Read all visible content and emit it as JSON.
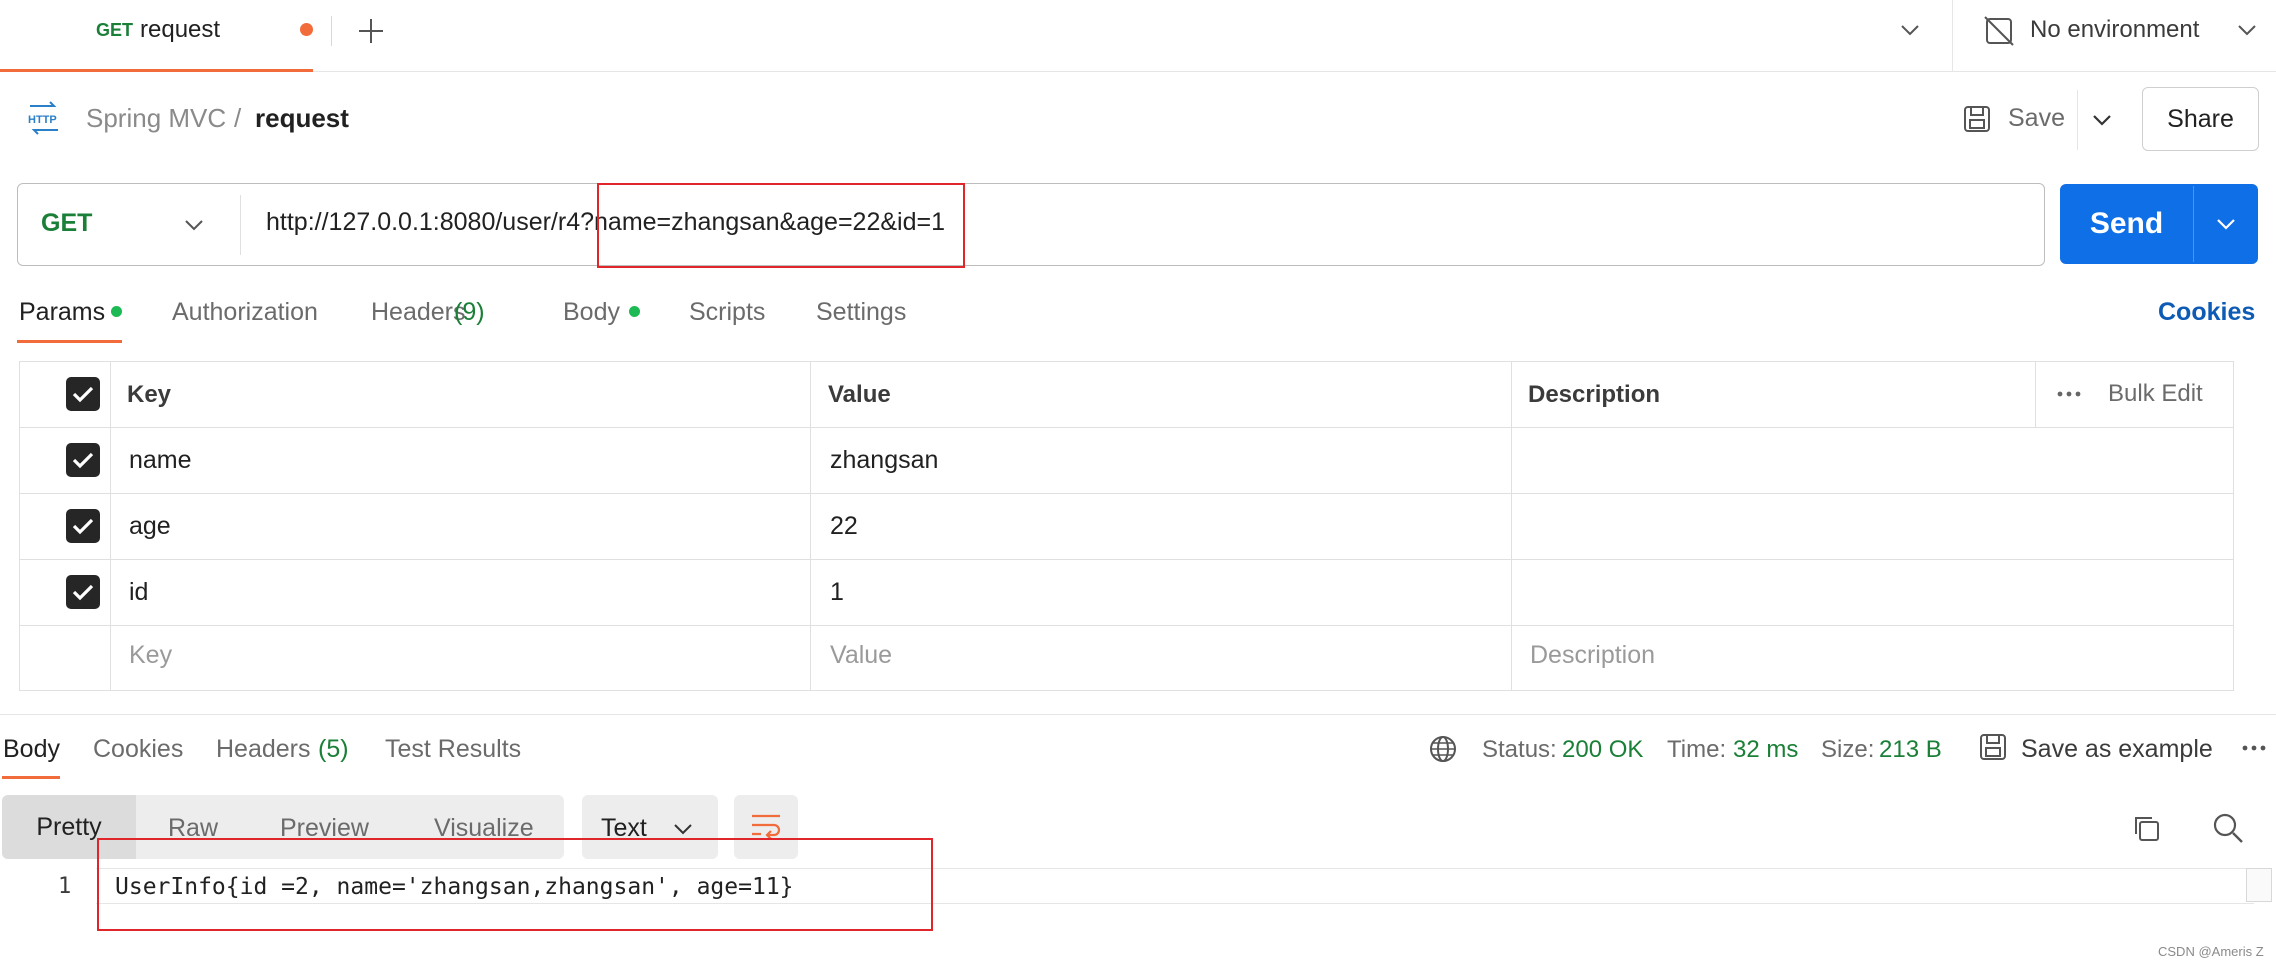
{
  "tab": {
    "method": "GET",
    "name": "request"
  },
  "environment": {
    "label": "No environment"
  },
  "breadcrumb": {
    "parent": "Spring MVC",
    "separator": "/",
    "current": "request"
  },
  "actions": {
    "save": "Save",
    "share": "Share"
  },
  "request": {
    "method": "GET",
    "url": "http://127.0.0.1:8080/user/r4?name=zhangsan&age=22&id=1",
    "send": "Send"
  },
  "request_tabs": {
    "params": "Params",
    "authorization": "Authorization",
    "headers": "Headers",
    "headers_count": "(9)",
    "body": "Body",
    "scripts": "Scripts",
    "settings": "Settings",
    "cookies": "Cookies"
  },
  "params_table": {
    "columns": {
      "key": "Key",
      "value": "Value",
      "description": "Description",
      "bulk_edit": "Bulk Edit"
    },
    "rows": [
      {
        "key": "name",
        "value": "zhangsan",
        "checked": true
      },
      {
        "key": "age",
        "value": "22",
        "checked": true
      },
      {
        "key": "id",
        "value": "1",
        "checked": true
      }
    ],
    "placeholders": {
      "key": "Key",
      "value": "Value",
      "description": "Description"
    }
  },
  "response_tabs": {
    "body": "Body",
    "cookies": "Cookies",
    "headers": "Headers",
    "headers_count": "(5)",
    "test_results": "Test Results"
  },
  "response_status": {
    "status_label": "Status:",
    "status_value": "200 OK",
    "time_label": "Time:",
    "time_value": "32 ms",
    "size_label": "Size:",
    "size_value": "213 B",
    "save_example": "Save as example"
  },
  "view_modes": {
    "pretty": "Pretty",
    "raw": "Raw",
    "preview": "Preview",
    "visualize": "Visualize"
  },
  "format": "Text",
  "response_body": {
    "line_number": "1",
    "line": "UserInfo{id =2, name='zhangsan,zhangsan', age=11}"
  },
  "watermark": "CSDN @Ameris Z",
  "colors": {
    "accent": "#f26b3a",
    "send": "#0f6fe6",
    "get": "#1a7f37",
    "highlight": "#e0262b"
  }
}
